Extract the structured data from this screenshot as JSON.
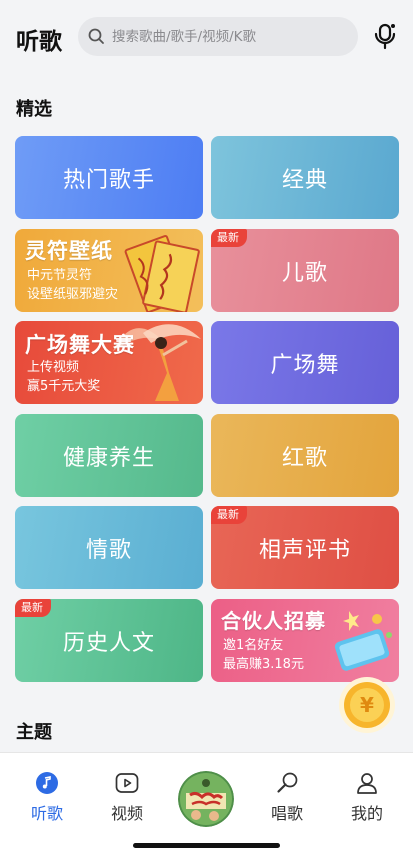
{
  "header": {
    "title": "听歌",
    "search_placeholder": "搜索歌曲/歌手/视频/K歌"
  },
  "sections": {
    "featured": "精选",
    "themes": "主题"
  },
  "cards": [
    {
      "label": "热门歌手"
    },
    {
      "label": "经典"
    },
    {
      "title": "灵符壁纸",
      "line1": "中元节灵符",
      "line2": "设壁纸驱邪避灾"
    },
    {
      "label": "儿歌",
      "badge": "最新"
    },
    {
      "title": "广场舞大赛",
      "line1": "上传视频",
      "line2": "赢5千元大奖"
    },
    {
      "label": "广场舞"
    },
    {
      "label": "健康养生"
    },
    {
      "label": "红歌"
    },
    {
      "label": "情歌"
    },
    {
      "label": "相声评书",
      "badge": "最新"
    },
    {
      "label": "历史人文",
      "badge": "最新"
    },
    {
      "title": "合伙人招募",
      "line1": "邀1名好友",
      "line2": "最高赚3.18元"
    }
  ],
  "coin_symbol": "¥",
  "tabs": [
    {
      "label": "听歌",
      "icon": "music-note-icon",
      "active": true
    },
    {
      "label": "视频",
      "icon": "play-icon",
      "active": false
    },
    {
      "label": "",
      "icon": "album-disc",
      "active": false
    },
    {
      "label": "唱歌",
      "icon": "microphone-icon",
      "active": false
    },
    {
      "label": "我的",
      "icon": "person-icon",
      "active": false
    }
  ],
  "colors": {
    "active_tab": "#2d6be4",
    "badge": "#e9433a",
    "background": "#f3f4f6"
  }
}
